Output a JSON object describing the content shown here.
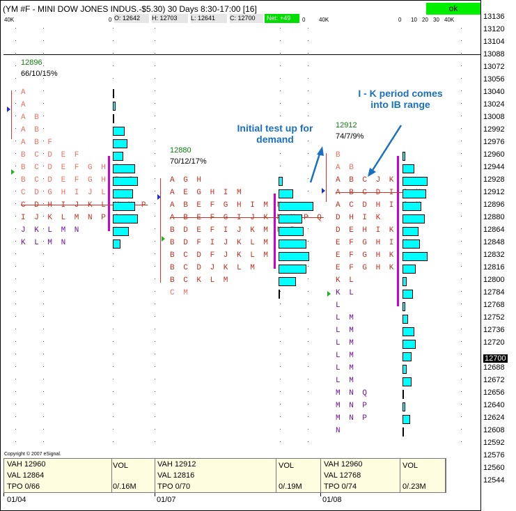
{
  "header": {
    "title": "(YM #F - MINI DOW JONES INDUS.-$5.30) 30 Days 8:30-17:00 [16]",
    "ok_label": "ok",
    "open": "O: 12642",
    "high": "H: 12703",
    "low": "L: 12641",
    "close": "C: 12700",
    "net": "Net: +49",
    "scale_40k": "40K",
    "scale_left": "0",
    "scale_right_labels": [
      "0",
      "10",
      "20",
      "30",
      "40K"
    ]
  },
  "price_axis": [
    "13136",
    "13120",
    "13104",
    "13088",
    "13072",
    "13056",
    "13040",
    "13024",
    "13008",
    "12992",
    "12976",
    "12960",
    "12944",
    "12928",
    "12912",
    "12896",
    "12880",
    "12864",
    "12848",
    "12832",
    "12816",
    "12800",
    "12784",
    "12768",
    "12752",
    "12736",
    "12720",
    "12700",
    "12688",
    "12672",
    "12656",
    "12640",
    "12624",
    "12608",
    "12592",
    "12576",
    "12560",
    "12544"
  ],
  "current_price": "12700",
  "copyright": "Copyright © 2007 eSignal.",
  "annotations": {
    "initial_test": "Initial test up for\ndemand",
    "ik_period": "I - K period comes\ninto IB range"
  },
  "chart_data": {
    "type": "table",
    "title": "",
    "sessions": [
      {
        "date": "01/04",
        "poc": "12896",
        "stat": "66/10/15%",
        "vah": "VAH 12960",
        "val": "VAL 12864",
        "tpo": "TPO 0/66",
        "vol_label": "VOL",
        "vol": "0/.16M",
        "rows": [
          {
            "price": 13040,
            "letters": "A",
            "vol": 0
          },
          {
            "price": 13024,
            "letters": "A",
            "vol": 2
          },
          {
            "price": 13008,
            "letters": "A B",
            "vol": 1
          },
          {
            "price": 12992,
            "letters": "A B",
            "vol": 8
          },
          {
            "price": 12976,
            "letters": "A B F",
            "vol": 10
          },
          {
            "price": 12960,
            "letters": "B C D E F",
            "vol": 7
          },
          {
            "price": 12944,
            "letters": "B C D E F G H I",
            "vol": 15
          },
          {
            "price": 12928,
            "letters": "B C D E F G H I J",
            "vol": 17
          },
          {
            "price": 12912,
            "letters": "C D G H I J L M",
            "vol": 14
          },
          {
            "price": 12896,
            "letters": "C D H I J K L M N P",
            "vol": 15
          },
          {
            "price": 12880,
            "letters": "I J K L M N P Q",
            "vol": 17
          },
          {
            "price": 12864,
            "letters": "J K L M N",
            "vol": 11
          },
          {
            "price": 12848,
            "letters": "K L M N",
            "vol": 5
          }
        ]
      },
      {
        "date": "01/07",
        "poc": "12880",
        "stat": "70/12/17%",
        "vah": "VAH 12912",
        "val": "VAL 12816",
        "tpo": "TPO 0/70",
        "vol_label": "VOL",
        "vol": "0/.19M",
        "rows": [
          {
            "price": 12928,
            "letters": "A G H",
            "vol": 3
          },
          {
            "price": 12912,
            "letters": "A E G H I M",
            "vol": 10
          },
          {
            "price": 12896,
            "letters": "A B E F G H I M N",
            "vol": 24
          },
          {
            "price": 12880,
            "letters": "A B E F G I J K M N P Q",
            "vol": 16
          },
          {
            "price": 12864,
            "letters": "B D E F I J K M N P",
            "vol": 17
          },
          {
            "price": 12848,
            "letters": "B D F I J K L M",
            "vol": 19
          },
          {
            "price": 12832,
            "letters": "B C D F J K L M",
            "vol": 21
          },
          {
            "price": 12816,
            "letters": "B C D J K L M",
            "vol": 19
          },
          {
            "price": 12800,
            "letters": "B C K L M",
            "vol": 12
          },
          {
            "price": 12784,
            "letters": "C M",
            "vol": 0
          }
        ]
      },
      {
        "date": "01/08",
        "poc": "12912",
        "stat": "74/7/9%",
        "vah": "VAH 12960",
        "val": "VAL 12768",
        "tpo": "TPO 0/74",
        "vol_label": "VOL",
        "vol": "0/.23M",
        "rows": [
          {
            "price": 12960,
            "letters": "B",
            "vol": 2
          },
          {
            "price": 12944,
            "letters": "A B",
            "vol": 8
          },
          {
            "price": 12928,
            "letters": "A B C J K",
            "vol": 17
          },
          {
            "price": 12912,
            "letters": "A B C D I J K",
            "vol": 16
          },
          {
            "price": 12896,
            "letters": "A C D H I J K",
            "vol": 13
          },
          {
            "price": 12880,
            "letters": "D H I K",
            "vol": 15
          },
          {
            "price": 12864,
            "letters": "D E H I K",
            "vol": 11
          },
          {
            "price": 12848,
            "letters": "E F G H I K",
            "vol": 12
          },
          {
            "price": 12832,
            "letters": "E F G H K",
            "vol": 17
          },
          {
            "price": 12816,
            "letters": "E F G H K",
            "vol": 9
          },
          {
            "price": 12800,
            "letters": "K L",
            "vol": 3
          },
          {
            "price": 12784,
            "letters": "K L",
            "vol": 7
          },
          {
            "price": 12768,
            "letters": "L",
            "vol": 2
          },
          {
            "price": 12752,
            "letters": "L M",
            "vol": 4
          },
          {
            "price": 12736,
            "letters": "L M",
            "vol": 8
          },
          {
            "price": 12720,
            "letters": "L M",
            "vol": 9
          },
          {
            "price": 12704,
            "letters": "L M",
            "vol": 6
          },
          {
            "price": 12688,
            "letters": "L M",
            "vol": 3
          },
          {
            "price": 12672,
            "letters": "L M",
            "vol": 6
          },
          {
            "price": 12656,
            "letters": "M N Q",
            "vol": 1
          },
          {
            "price": 12640,
            "letters": "M N P",
            "vol": 2
          },
          {
            "price": 12624,
            "letters": "M N P",
            "vol": 5
          },
          {
            "price": 12608,
            "letters": "N",
            "vol": 0
          }
        ]
      }
    ]
  }
}
